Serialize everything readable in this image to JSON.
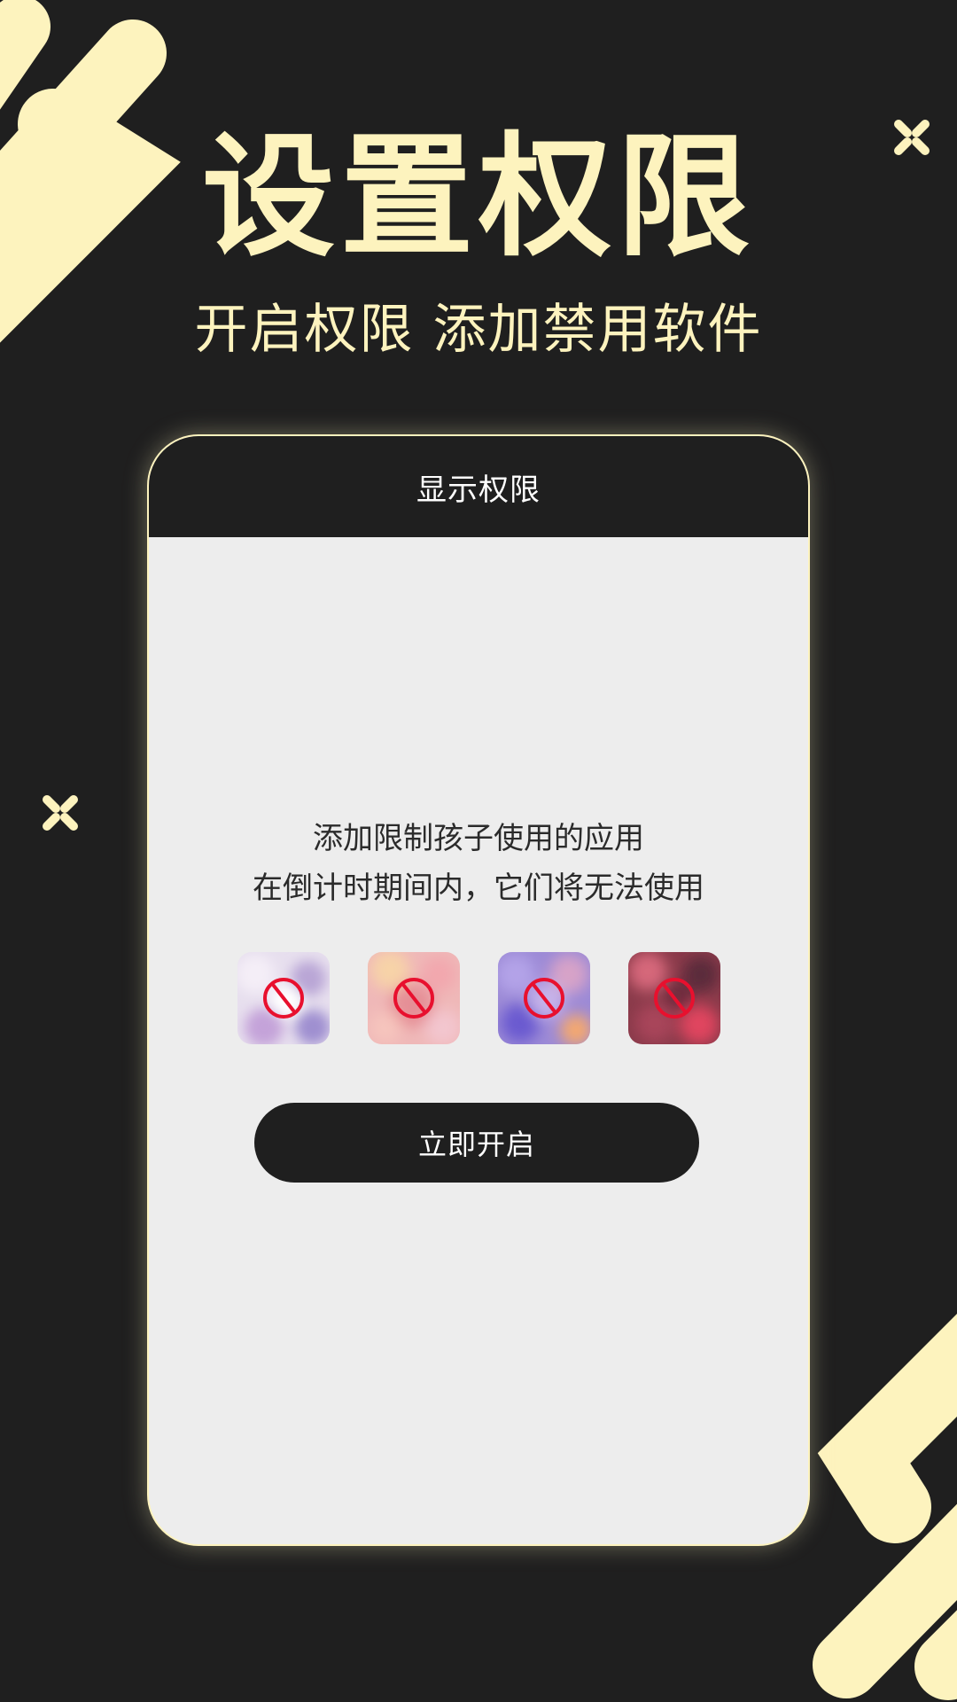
{
  "colors": {
    "background": "#1f1f1f",
    "accent": "#fdf3be",
    "card_body": "#ededed",
    "ban_red": "#e8102e"
  },
  "headline": "设置权限",
  "subline": "开启权限 添加禁用软件",
  "card": {
    "header_title": "显示权限",
    "description_line1": "添加限制孩子使用的应用",
    "description_line2": "在倒计时期间内，它们将无法使用",
    "blocked_apps": [
      {
        "icon": "blurred-app-icon-1",
        "badge": "ban-icon"
      },
      {
        "icon": "blurred-app-icon-2",
        "badge": "ban-icon"
      },
      {
        "icon": "blurred-app-icon-3",
        "badge": "ban-icon"
      },
      {
        "icon": "blurred-app-icon-4",
        "badge": "ban-icon"
      }
    ],
    "button_label": "立即开启"
  }
}
